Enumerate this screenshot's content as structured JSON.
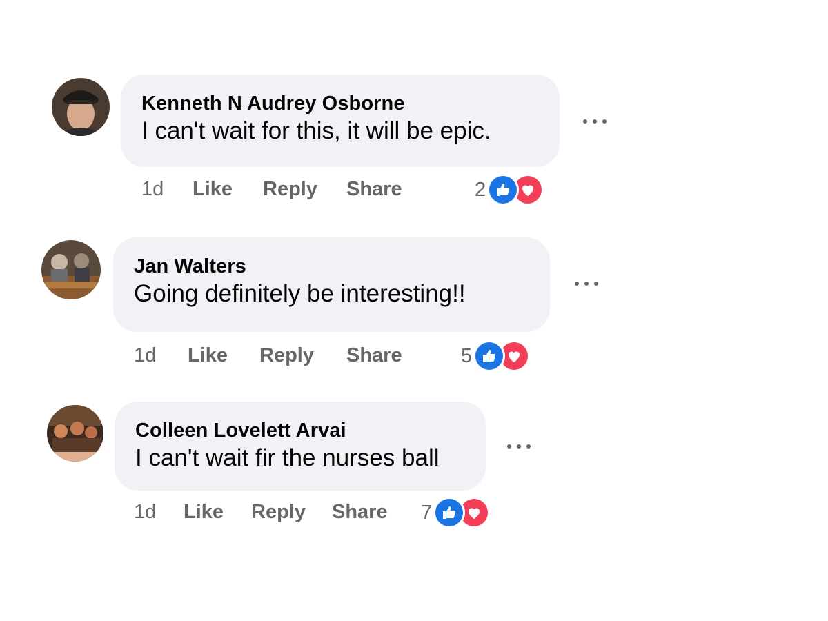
{
  "comments": [
    {
      "author": "Kenneth N Audrey Osborne",
      "text": "I can't wait for this, it will be epic.",
      "time": "1d",
      "like_label": "Like",
      "reply_label": "Reply",
      "share_label": "Share",
      "reaction_count": "2",
      "reactions": [
        "like-icon",
        "love-icon"
      ]
    },
    {
      "author": "Jan Walters",
      "text": "Going definitely be interesting!!",
      "time": "1d",
      "like_label": "Like",
      "reply_label": "Reply",
      "share_label": "Share",
      "reaction_count": "5",
      "reactions": [
        "like-icon",
        "love-icon"
      ]
    },
    {
      "author": "Colleen Lovelett Arvai",
      "text": "I can't wait fir the nurses ball",
      "time": "1d",
      "like_label": "Like",
      "reply_label": "Reply",
      "share_label": "Share",
      "reaction_count": "7",
      "reactions": [
        "like-icon",
        "love-icon"
      ]
    }
  ],
  "colors": {
    "bubble": "#f0f2f5",
    "secondary_text": "#65676b",
    "like_blue": "#1b74e4",
    "love_red": "#f33e58"
  }
}
